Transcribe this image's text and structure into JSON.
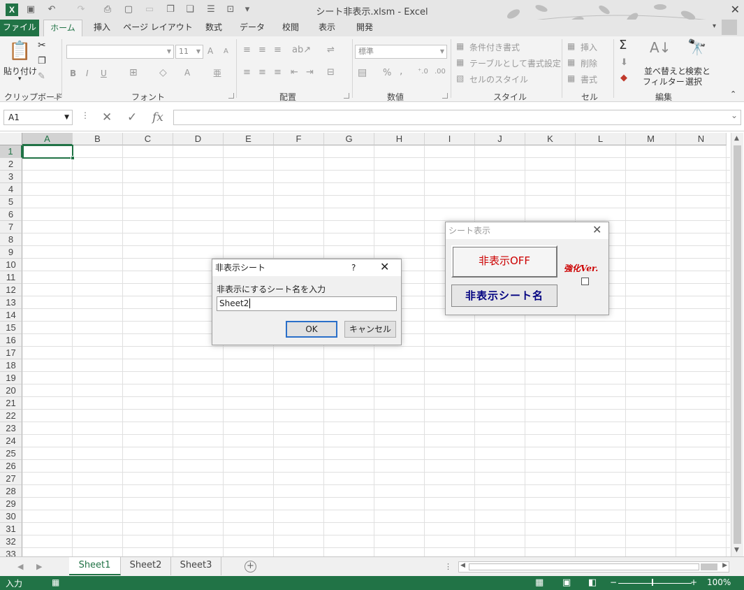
{
  "window": {
    "title": "シート非表示.xlsm - Excel",
    "app_icon": "X"
  },
  "qat": {
    "customize": "▾"
  },
  "ribbon_tabs": [
    "ファイル",
    "ホーム",
    "挿入",
    "ページ レイアウト",
    "数式",
    "データ",
    "校閲",
    "表示",
    "開発"
  ],
  "ribbon": {
    "clipboard": {
      "paste": "貼り付け",
      "label": "クリップボード"
    },
    "font": {
      "name": "",
      "size": "11",
      "bold": "B",
      "italic": "I",
      "underline": "U",
      "grow": "A",
      "shrink": "A",
      "color_a": "A",
      "label": "フォント"
    },
    "alignment": {
      "label": "配置"
    },
    "number": {
      "format": "標準",
      "percent": "%",
      "comma": ",",
      "label": "数値"
    },
    "styles": {
      "conditional": "条件付き書式",
      "table": "テーブルとして書式設定",
      "cell_style": "セルのスタイル",
      "label": "スタイル"
    },
    "cells": {
      "insert": "挿入",
      "delete": "削除",
      "format": "書式",
      "label": "セル"
    },
    "editing": {
      "sum": "Σ",
      "sort_filter_1": "並べ替えと",
      "sort_filter_2": "フィルター",
      "find_1": "検索と",
      "find_2": "選択",
      "label": "編集"
    }
  },
  "formula_bar": {
    "name_box": "A1",
    "fx": "fx",
    "formula": ""
  },
  "grid": {
    "columns": [
      "A",
      "B",
      "C",
      "D",
      "E",
      "F",
      "G",
      "H",
      "I",
      "J",
      "K",
      "L",
      "M",
      "N"
    ],
    "rows": [
      "1",
      "2",
      "3",
      "4",
      "5",
      "6",
      "7",
      "8",
      "9",
      "10",
      "11",
      "12",
      "13",
      "14",
      "15",
      "16",
      "17",
      "18",
      "19",
      "20",
      "21",
      "22",
      "23",
      "24",
      "25",
      "26",
      "27",
      "28",
      "29",
      "30",
      "31",
      "32",
      "33"
    ],
    "active_cell": "A1"
  },
  "sheets": [
    "Sheet1",
    "Sheet2",
    "Sheet3"
  ],
  "active_sheet": "Sheet1",
  "status": {
    "mode": "入力",
    "zoom": "100%"
  },
  "input_dialog": {
    "title": "非表示シート",
    "help": "?",
    "prompt": "非表示にするシート名を入力",
    "value": "Sheet2",
    "ok": "OK",
    "cancel": "キャンセル"
  },
  "userform": {
    "title": "シート表示",
    "toggle_button": "非表示OFF",
    "name_button": "非表示シート名",
    "version_label": "強化Ver."
  },
  "colors": {
    "excel_green": "#217346",
    "dialog_red": "#cc0000",
    "dialog_navy": "#000080"
  }
}
